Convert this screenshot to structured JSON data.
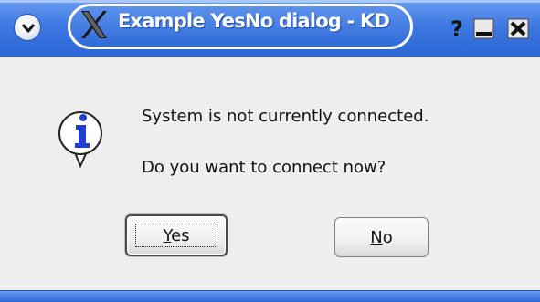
{
  "window": {
    "title": "Example YesNo dialog - KD",
    "menu_button_icon": "window-menu-icon",
    "app_icon": "x-logo-icon",
    "help_button_icon": "help-icon",
    "minimize_button_icon": "minimize-icon",
    "close_button_icon": "close-icon"
  },
  "dialog": {
    "icon": "info-icon",
    "message_line1": "System is not currently connected.",
    "message_line2": "Do you want to connect now?",
    "buttons": {
      "yes": {
        "mnemonic": "Y",
        "rest": "es"
      },
      "no": {
        "mnemonic": "N",
        "rest": "o"
      }
    }
  },
  "colors": {
    "titlebar": "#3d78e2",
    "background": "#eeeeee",
    "info_icon": "#1f3fd0"
  }
}
